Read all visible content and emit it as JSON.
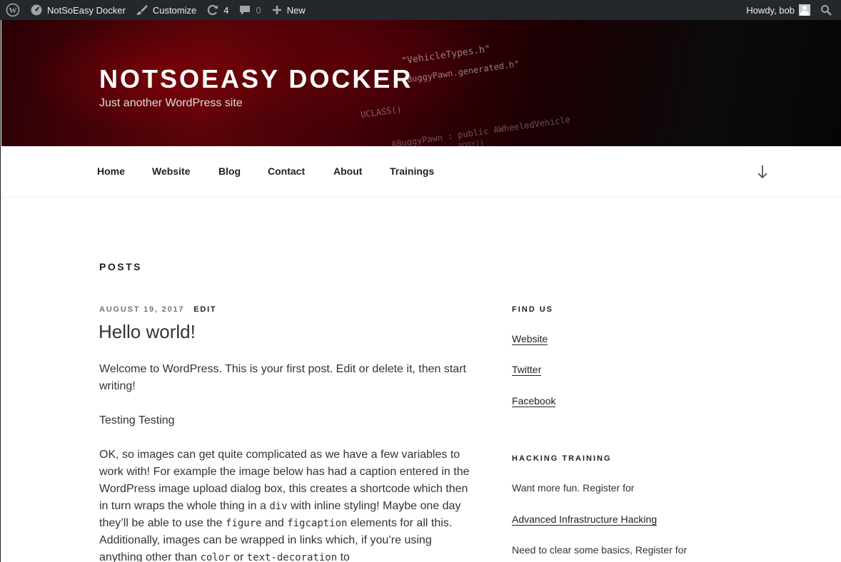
{
  "admin_bar": {
    "site_name": "NotSoEasy Docker",
    "customize": "Customize",
    "updates_count": "4",
    "comments_count": "0",
    "new_label": "New",
    "howdy": "Howdy, bob",
    "bg_color": "#23282d"
  },
  "header": {
    "title": "NotSoEasy Docker",
    "description": "Just another WordPress site",
    "code_lines": [
      "\"VehicleTypes.h\"",
      "eBuggyPawn.generated.h\"",
      "UCLASS()",
      "ABuggyPawn : public AWheeledVehicle",
      "BODY()"
    ]
  },
  "nav": {
    "items": [
      "Home",
      "Website",
      "Blog",
      "Contact",
      "About",
      "Trainings"
    ]
  },
  "main": {
    "heading": "Posts",
    "post": {
      "date": "August 19, 2017",
      "edit": "Edit",
      "title": "Hello world!",
      "para1": "Welcome to WordPress. This is your first post. Edit or delete it, then start writing!",
      "para2": "Testing Testing",
      "para3": {
        "t1": "OK, so images can get quite complicated as we have a few variables to work with! For example the image below has had a caption entered in the WordPress image upload dialog box, this creates a shortcode which then in turn wraps the whole thing in a ",
        "c1": "div",
        "t2": " with inline styling! Maybe one day they’ll be able to use the ",
        "c2": "figure",
        "t3": " and ",
        "c3": "figcaption",
        "t4": " elements for all this. Additionally, images can be wrapped in links which, if you’re using anything other than ",
        "c4": "color",
        "t5": " or ",
        "c5": "text-decoration",
        "t6": " to"
      }
    }
  },
  "sidebar": {
    "find_us": {
      "title": "Find Us",
      "links": [
        "Website",
        "Twitter",
        "Facebook"
      ]
    },
    "hacking": {
      "title": "Hacking Training",
      "text1": "Want more fun. Register for",
      "link": "Advanced Infrastructure Hacking",
      "text2": "Need to clear some basics, Register for"
    }
  }
}
